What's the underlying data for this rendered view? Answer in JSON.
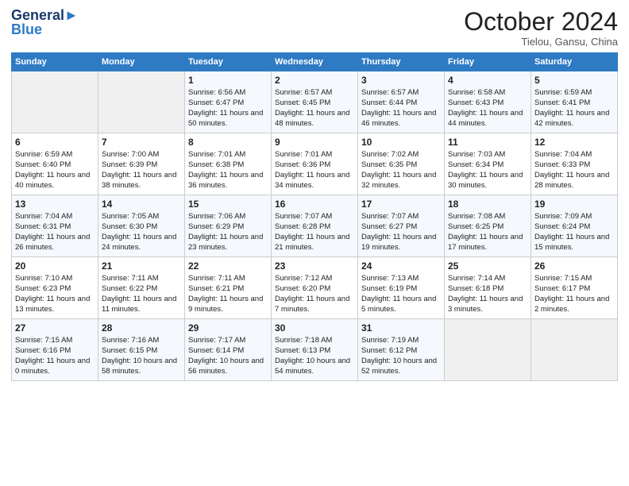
{
  "logo": {
    "line1": "General",
    "line2": "Blue"
  },
  "header": {
    "month": "October 2024",
    "location": "Tielou, Gansu, China"
  },
  "weekdays": [
    "Sunday",
    "Monday",
    "Tuesday",
    "Wednesday",
    "Thursday",
    "Friday",
    "Saturday"
  ],
  "weeks": [
    [
      {
        "day": "",
        "sunrise": "",
        "sunset": "",
        "daylight": "",
        "empty": true
      },
      {
        "day": "",
        "sunrise": "",
        "sunset": "",
        "daylight": "",
        "empty": true
      },
      {
        "day": "1",
        "sunrise": "Sunrise: 6:56 AM",
        "sunset": "Sunset: 6:47 PM",
        "daylight": "Daylight: 11 hours and 50 minutes.",
        "empty": false
      },
      {
        "day": "2",
        "sunrise": "Sunrise: 6:57 AM",
        "sunset": "Sunset: 6:45 PM",
        "daylight": "Daylight: 11 hours and 48 minutes.",
        "empty": false
      },
      {
        "day": "3",
        "sunrise": "Sunrise: 6:57 AM",
        "sunset": "Sunset: 6:44 PM",
        "daylight": "Daylight: 11 hours and 46 minutes.",
        "empty": false
      },
      {
        "day": "4",
        "sunrise": "Sunrise: 6:58 AM",
        "sunset": "Sunset: 6:43 PM",
        "daylight": "Daylight: 11 hours and 44 minutes.",
        "empty": false
      },
      {
        "day": "5",
        "sunrise": "Sunrise: 6:59 AM",
        "sunset": "Sunset: 6:41 PM",
        "daylight": "Daylight: 11 hours and 42 minutes.",
        "empty": false
      }
    ],
    [
      {
        "day": "6",
        "sunrise": "Sunrise: 6:59 AM",
        "sunset": "Sunset: 6:40 PM",
        "daylight": "Daylight: 11 hours and 40 minutes.",
        "empty": false
      },
      {
        "day": "7",
        "sunrise": "Sunrise: 7:00 AM",
        "sunset": "Sunset: 6:39 PM",
        "daylight": "Daylight: 11 hours and 38 minutes.",
        "empty": false
      },
      {
        "day": "8",
        "sunrise": "Sunrise: 7:01 AM",
        "sunset": "Sunset: 6:38 PM",
        "daylight": "Daylight: 11 hours and 36 minutes.",
        "empty": false
      },
      {
        "day": "9",
        "sunrise": "Sunrise: 7:01 AM",
        "sunset": "Sunset: 6:36 PM",
        "daylight": "Daylight: 11 hours and 34 minutes.",
        "empty": false
      },
      {
        "day": "10",
        "sunrise": "Sunrise: 7:02 AM",
        "sunset": "Sunset: 6:35 PM",
        "daylight": "Daylight: 11 hours and 32 minutes.",
        "empty": false
      },
      {
        "day": "11",
        "sunrise": "Sunrise: 7:03 AM",
        "sunset": "Sunset: 6:34 PM",
        "daylight": "Daylight: 11 hours and 30 minutes.",
        "empty": false
      },
      {
        "day": "12",
        "sunrise": "Sunrise: 7:04 AM",
        "sunset": "Sunset: 6:33 PM",
        "daylight": "Daylight: 11 hours and 28 minutes.",
        "empty": false
      }
    ],
    [
      {
        "day": "13",
        "sunrise": "Sunrise: 7:04 AM",
        "sunset": "Sunset: 6:31 PM",
        "daylight": "Daylight: 11 hours and 26 minutes.",
        "empty": false
      },
      {
        "day": "14",
        "sunrise": "Sunrise: 7:05 AM",
        "sunset": "Sunset: 6:30 PM",
        "daylight": "Daylight: 11 hours and 24 minutes.",
        "empty": false
      },
      {
        "day": "15",
        "sunrise": "Sunrise: 7:06 AM",
        "sunset": "Sunset: 6:29 PM",
        "daylight": "Daylight: 11 hours and 23 minutes.",
        "empty": false
      },
      {
        "day": "16",
        "sunrise": "Sunrise: 7:07 AM",
        "sunset": "Sunset: 6:28 PM",
        "daylight": "Daylight: 11 hours and 21 minutes.",
        "empty": false
      },
      {
        "day": "17",
        "sunrise": "Sunrise: 7:07 AM",
        "sunset": "Sunset: 6:27 PM",
        "daylight": "Daylight: 11 hours and 19 minutes.",
        "empty": false
      },
      {
        "day": "18",
        "sunrise": "Sunrise: 7:08 AM",
        "sunset": "Sunset: 6:25 PM",
        "daylight": "Daylight: 11 hours and 17 minutes.",
        "empty": false
      },
      {
        "day": "19",
        "sunrise": "Sunrise: 7:09 AM",
        "sunset": "Sunset: 6:24 PM",
        "daylight": "Daylight: 11 hours and 15 minutes.",
        "empty": false
      }
    ],
    [
      {
        "day": "20",
        "sunrise": "Sunrise: 7:10 AM",
        "sunset": "Sunset: 6:23 PM",
        "daylight": "Daylight: 11 hours and 13 minutes.",
        "empty": false
      },
      {
        "day": "21",
        "sunrise": "Sunrise: 7:11 AM",
        "sunset": "Sunset: 6:22 PM",
        "daylight": "Daylight: 11 hours and 11 minutes.",
        "empty": false
      },
      {
        "day": "22",
        "sunrise": "Sunrise: 7:11 AM",
        "sunset": "Sunset: 6:21 PM",
        "daylight": "Daylight: 11 hours and 9 minutes.",
        "empty": false
      },
      {
        "day": "23",
        "sunrise": "Sunrise: 7:12 AM",
        "sunset": "Sunset: 6:20 PM",
        "daylight": "Daylight: 11 hours and 7 minutes.",
        "empty": false
      },
      {
        "day": "24",
        "sunrise": "Sunrise: 7:13 AM",
        "sunset": "Sunset: 6:19 PM",
        "daylight": "Daylight: 11 hours and 5 minutes.",
        "empty": false
      },
      {
        "day": "25",
        "sunrise": "Sunrise: 7:14 AM",
        "sunset": "Sunset: 6:18 PM",
        "daylight": "Daylight: 11 hours and 3 minutes.",
        "empty": false
      },
      {
        "day": "26",
        "sunrise": "Sunrise: 7:15 AM",
        "sunset": "Sunset: 6:17 PM",
        "daylight": "Daylight: 11 hours and 2 minutes.",
        "empty": false
      }
    ],
    [
      {
        "day": "27",
        "sunrise": "Sunrise: 7:15 AM",
        "sunset": "Sunset: 6:16 PM",
        "daylight": "Daylight: 11 hours and 0 minutes.",
        "empty": false
      },
      {
        "day": "28",
        "sunrise": "Sunrise: 7:16 AM",
        "sunset": "Sunset: 6:15 PM",
        "daylight": "Daylight: 10 hours and 58 minutes.",
        "empty": false
      },
      {
        "day": "29",
        "sunrise": "Sunrise: 7:17 AM",
        "sunset": "Sunset: 6:14 PM",
        "daylight": "Daylight: 10 hours and 56 minutes.",
        "empty": false
      },
      {
        "day": "30",
        "sunrise": "Sunrise: 7:18 AM",
        "sunset": "Sunset: 6:13 PM",
        "daylight": "Daylight: 10 hours and 54 minutes.",
        "empty": false
      },
      {
        "day": "31",
        "sunrise": "Sunrise: 7:19 AM",
        "sunset": "Sunset: 6:12 PM",
        "daylight": "Daylight: 10 hours and 52 minutes.",
        "empty": false
      },
      {
        "day": "",
        "sunrise": "",
        "sunset": "",
        "daylight": "",
        "empty": true
      },
      {
        "day": "",
        "sunrise": "",
        "sunset": "",
        "daylight": "",
        "empty": true
      }
    ]
  ]
}
